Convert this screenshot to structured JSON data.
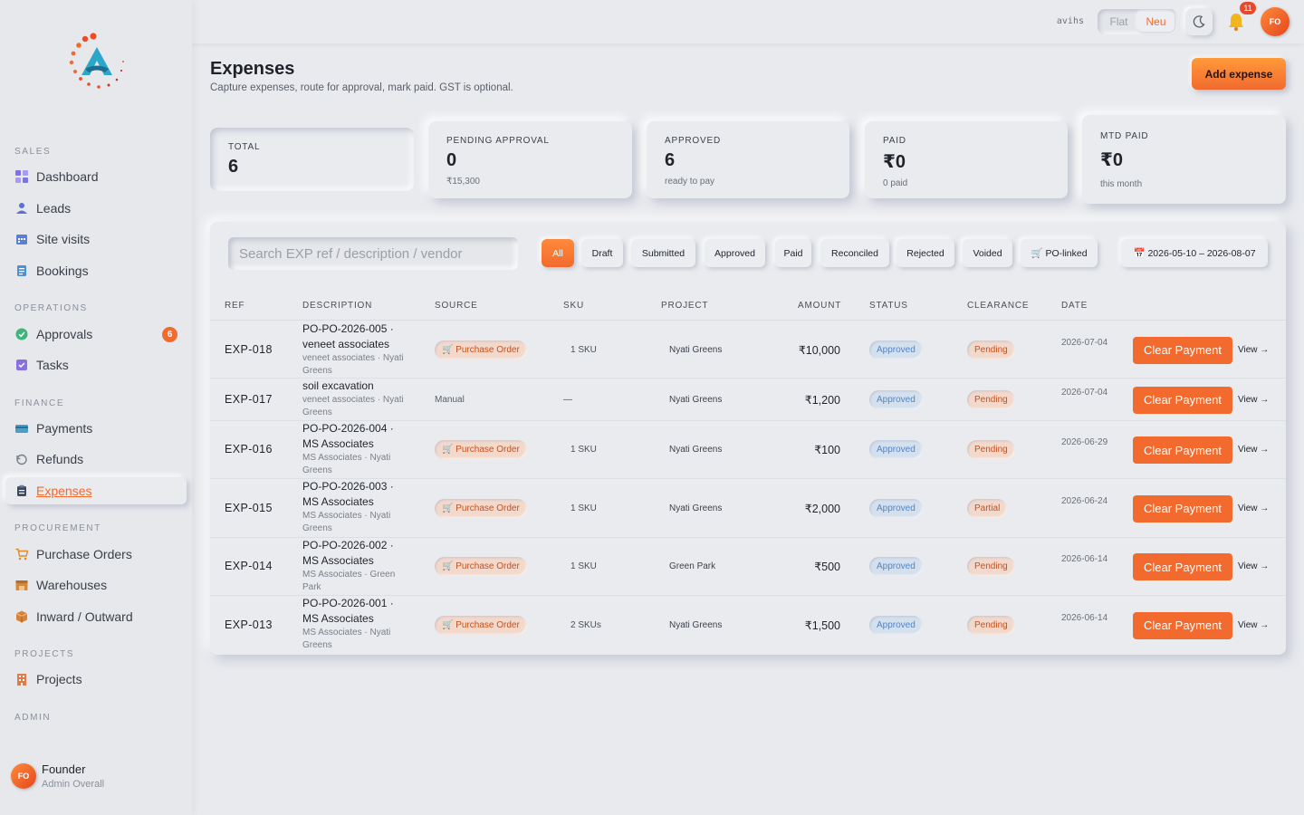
{
  "sidebar": {
    "sections": [
      {
        "title": "SALES",
        "items": [
          {
            "label": "Dashboard",
            "icon": "grid-icon"
          },
          {
            "label": "Leads",
            "icon": "user-icon"
          },
          {
            "label": "Site visits",
            "icon": "calendar-icon"
          },
          {
            "label": "Bookings",
            "icon": "document-icon"
          }
        ]
      },
      {
        "title": "OPERATIONS",
        "items": [
          {
            "label": "Approvals",
            "icon": "check-circle-icon",
            "badge": "6"
          },
          {
            "label": "Tasks",
            "icon": "checkbox-icon"
          }
        ]
      },
      {
        "title": "FINANCE",
        "items": [
          {
            "label": "Payments",
            "icon": "card-icon"
          },
          {
            "label": "Refunds",
            "icon": "refund-icon"
          },
          {
            "label": "Expenses",
            "icon": "clipboard-icon",
            "active": true
          }
        ]
      },
      {
        "title": "PROCUREMENT",
        "items": [
          {
            "label": "Purchase Orders",
            "icon": "cart-icon"
          },
          {
            "label": "Warehouses",
            "icon": "warehouse-icon"
          },
          {
            "label": "Inward / Outward",
            "icon": "box-icon"
          }
        ]
      },
      {
        "title": "PROJECTS",
        "items": [
          {
            "label": "Projects",
            "icon": "building-icon"
          }
        ]
      },
      {
        "title": "ADMIN",
        "items": []
      }
    ],
    "user": {
      "initials": "FO",
      "name": "Founder",
      "role": "Admin Overall"
    }
  },
  "topbar": {
    "username": "avihs",
    "toggle_off": "Flat",
    "toggle_on": "Neu",
    "notifications": "11",
    "avatar_initials": "FO"
  },
  "header": {
    "title": "Expenses",
    "subtitle": "Capture expenses, route for approval, mark paid. GST is optional.",
    "add_button": "Add expense"
  },
  "stats": [
    {
      "label": "TOTAL",
      "value": "6",
      "sub": ""
    },
    {
      "label": "PENDING APPROVAL",
      "value": "0",
      "sub": "₹15,300"
    },
    {
      "label": "APPROVED",
      "value": "6",
      "sub": "ready to pay"
    },
    {
      "label": "PAID",
      "value": "₹0",
      "sub": "0 paid"
    },
    {
      "label": "MTD PAID",
      "value": "₹0",
      "sub": "this month"
    }
  ],
  "filters": {
    "search_placeholder": "Search EXP ref / description / vendor",
    "chips": [
      "All",
      "Draft",
      "Submitted",
      "Approved",
      "Paid",
      "Reconciled",
      "Rejected",
      "Voided",
      "🛒 PO-linked"
    ],
    "active_chip": "All",
    "date_range": "📅 2026-05-10 – 2026-08-07"
  },
  "table": {
    "columns": [
      "REF",
      "DESCRIPTION",
      "SOURCE",
      "SKU",
      "PROJECT",
      "AMOUNT",
      "STATUS",
      "CLEARANCE",
      "DATE"
    ],
    "action_label": "Clear Payment",
    "view_label": "View →",
    "rows": [
      {
        "ref": "EXP-018",
        "desc_main": "PO-PO-2026-005 · veneet associates",
        "desc_sub": "veneet associates · Nyati Greens",
        "source": "🛒 Purchase Order",
        "source_type": "po",
        "sku": "1 SKU",
        "project": "Nyati Greens",
        "amount": "₹10,000",
        "status": "Approved",
        "clearance": "Pending",
        "date": "2026-07-04"
      },
      {
        "ref": "EXP-017",
        "desc_main": "soil excavation",
        "desc_sub": "veneet associates · Nyati Greens",
        "source": "Manual",
        "source_type": "manual",
        "sku": "—",
        "project": "Nyati Greens",
        "amount": "₹1,200",
        "status": "Approved",
        "clearance": "Pending",
        "date": "2026-07-04"
      },
      {
        "ref": "EXP-016",
        "desc_main": "PO-PO-2026-004 · MS Associates",
        "desc_sub": "MS Associates · Nyati Greens",
        "source": "🛒 Purchase Order",
        "source_type": "po",
        "sku": "1 SKU",
        "project": "Nyati Greens",
        "amount": "₹100",
        "status": "Approved",
        "clearance": "Pending",
        "date": "2026-06-29"
      },
      {
        "ref": "EXP-015",
        "desc_main": "PO-PO-2026-003 · MS Associates",
        "desc_sub": "MS Associates · Nyati Greens",
        "source": "🛒 Purchase Order",
        "source_type": "po",
        "sku": "1 SKU",
        "project": "Nyati Greens",
        "amount": "₹2,000",
        "status": "Approved",
        "clearance": "Partial",
        "date": "2026-06-24"
      },
      {
        "ref": "EXP-014",
        "desc_main": "PO-PO-2026-002 · MS Associates",
        "desc_sub": "MS Associates · Green Park",
        "source": "🛒 Purchase Order",
        "source_type": "po",
        "sku": "1 SKU",
        "project": "Green Park",
        "amount": "₹500",
        "status": "Approved",
        "clearance": "Pending",
        "date": "2026-06-14"
      },
      {
        "ref": "EXP-013",
        "desc_main": "PO-PO-2026-001 · MS Associates",
        "desc_sub": "MS Associates · Nyati Greens",
        "source": "🛒 Purchase Order",
        "source_type": "po",
        "sku": "2 SKUs",
        "project": "Nyati Greens",
        "amount": "₹1,500",
        "status": "Approved",
        "clearance": "Pending",
        "date": "2026-06-14"
      }
    ]
  }
}
